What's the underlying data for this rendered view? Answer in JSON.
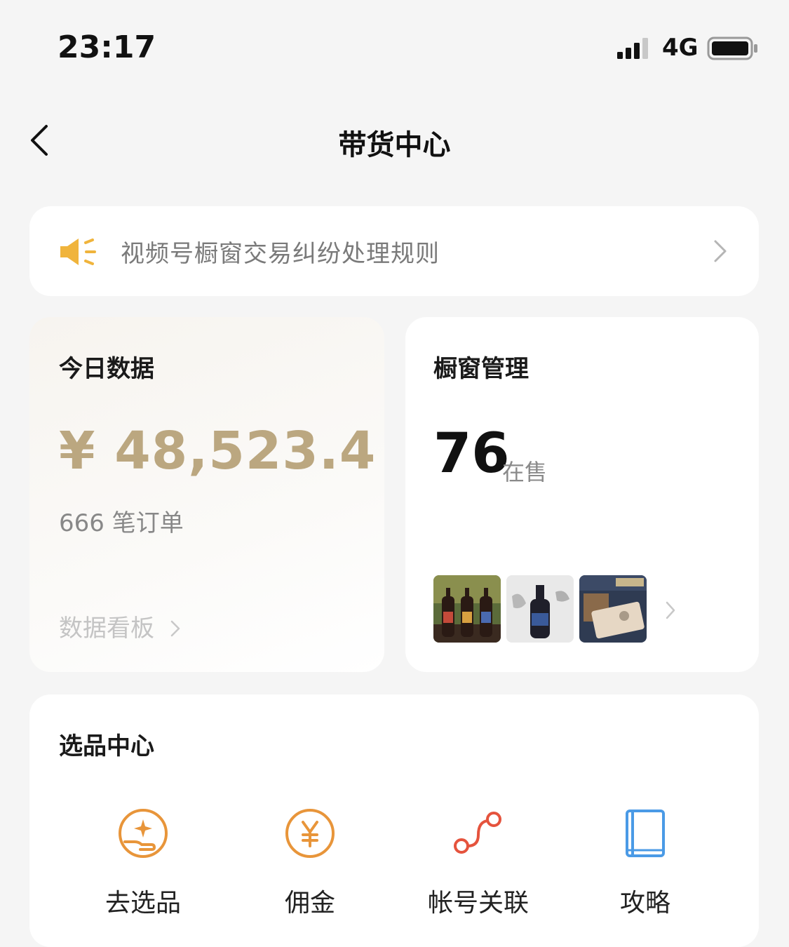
{
  "status_bar": {
    "time": "23:17",
    "network": "4G"
  },
  "nav": {
    "title": "带货中心",
    "back_icon": "chevron-left-icon"
  },
  "notice": {
    "icon": "speaker-icon",
    "text": "视频号橱窗交易纠纷处理规则"
  },
  "today": {
    "title": "今日数据",
    "gmv": "¥ 48,523.4",
    "orders": "666 笔订单",
    "dashboard_link": "数据看板"
  },
  "window": {
    "title": "橱窗管理",
    "count": "76",
    "count_label": "在售",
    "thumbnails": [
      "product-wine-bottles",
      "product-liquor-bottle",
      "product-boxed-goods"
    ]
  },
  "select_center": {
    "title": "选品中心",
    "tools": [
      {
        "label": "去选品",
        "icon": "hand-sparkle-icon",
        "color": "#e8953a"
      },
      {
        "label": "佣金",
        "icon": "yuan-coin-icon",
        "color": "#e8953a"
      },
      {
        "label": "帐号关联",
        "icon": "link-path-icon",
        "color": "#e5533d"
      },
      {
        "label": "攻略",
        "icon": "book-icon",
        "color": "#4a9ae6"
      }
    ]
  },
  "colors": {
    "gmv": "#bba780",
    "notice_icon": "#f0b43c",
    "background": "#f5f5f5"
  }
}
